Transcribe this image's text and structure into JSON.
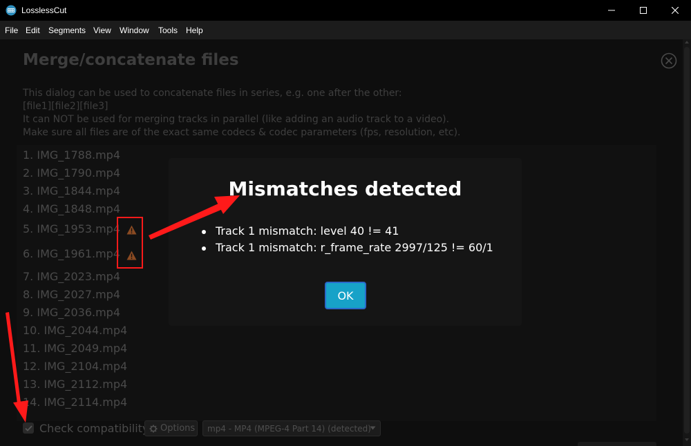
{
  "window": {
    "title": "LosslessCut"
  },
  "menu": {
    "items": [
      "File",
      "Edit",
      "Segments",
      "View",
      "Window",
      "Tools",
      "Help"
    ]
  },
  "dialog": {
    "title": "Merge/concatenate files",
    "description": [
      "This dialog can be used to concatenate files in series, e.g. one after the other:",
      "[file1][file2][file3]",
      "It can NOT be used for merging tracks in parallel (like adding an audio track to a video).",
      "Make sure all files are of the exact same codecs & codec parameters (fps, resolution, etc)."
    ],
    "files": [
      "1. IMG_1788.mp4",
      "2. IMG_1790.mp4",
      "3. IMG_1844.mp4",
      "4. IMG_1848.mp4",
      "5. IMG_1953.mp4",
      "6. IMG_1961.mp4",
      "7. IMG_2023.mp4",
      "8. IMG_2027.mp4",
      "9. IMG_2036.mp4",
      "10. IMG_2044.mp4",
      "11. IMG_2049.mp4",
      "12. IMG_2104.mp4",
      "13. IMG_2112.mp4",
      "14. IMG_2114.mp4"
    ],
    "check_compatibility_label": "Check compatibility",
    "check_compatibility_checked": true,
    "options_label": "Options",
    "format_value": "mp4 - MP4 (MPEG-4 Part 14) (detected)"
  },
  "modal": {
    "title": "Mismatches detected",
    "mismatches": [
      "Track 1 mismatch: level 40 != 41",
      "Track 1 mismatch: r_frame_rate 2997/125 != 60/1"
    ],
    "ok_label": "OK"
  },
  "colors": {
    "accent": "#17a2c8",
    "annotation": "#ff1a1a",
    "warning": "#a0522d"
  },
  "icons": {
    "app": "losslesscut-logo-icon",
    "minimize": "minimize-icon",
    "maximize": "maximize-icon",
    "close": "close-icon",
    "dialog_close": "close-circle-icon",
    "warning": "warning-triangle-icon",
    "gear": "gear-icon",
    "chevron": "chevron-down-icon",
    "check": "check-icon"
  }
}
